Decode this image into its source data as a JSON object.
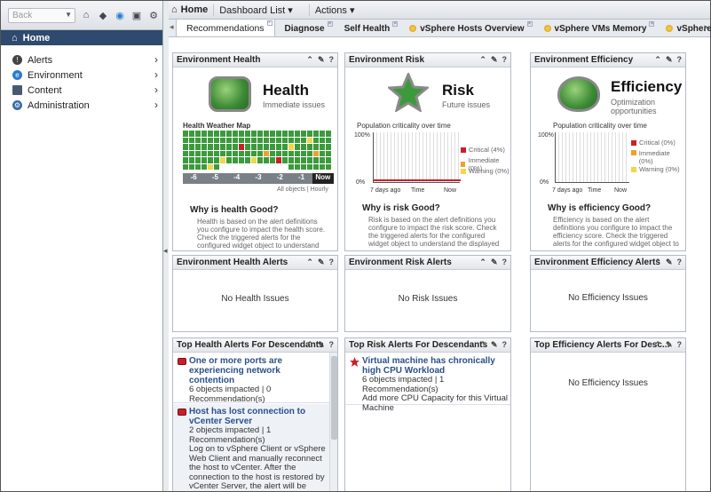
{
  "left": {
    "back_label": "Back",
    "home_label": "Home",
    "nav": [
      {
        "label": "Alerts"
      },
      {
        "label": "Environment"
      },
      {
        "label": "Content"
      },
      {
        "label": "Administration"
      }
    ]
  },
  "toolbar": {
    "home": "Home",
    "dashboard_list": "Dashboard List",
    "actions": "Actions"
  },
  "tabs": [
    "Recommendations",
    "Diagnose",
    "Self Health",
    "vSphere Hosts Overview",
    "vSphere VMs Memory",
    "vSphere V"
  ],
  "health": {
    "header": "Environment Health",
    "title": "Health",
    "subtitle": "Immediate issues",
    "map_title": "Health Weather Map",
    "times": [
      "-6",
      "-5",
      "-4",
      "-3",
      "-2",
      "-1",
      "Now"
    ],
    "footer": "All objects | Hourly",
    "why": "Why is health Good?",
    "desc": "Health is based on the alert definitions you configure to impact the health score. Check the triggered alerts for the configured widget object to understand the displayed state, including"
  },
  "risk": {
    "header": "Environment Risk",
    "title": "Risk",
    "subtitle": "Future issues",
    "plot_title": "Population criticality over time",
    "y_top": "100%",
    "y_bottom": "0%",
    "x_labels": [
      "7 days ago",
      "Time",
      "Now"
    ],
    "legend": [
      "Critical (4%)",
      "Immediate (0%)",
      "Warning (0%)"
    ],
    "why": "Why is risk Good?",
    "desc": "Risk is based on the alert definitions you configure to impact the risk score. Check the triggered alerts for the configured widget object to understand the displayed state, including child objects."
  },
  "eff": {
    "header": "Environment Efficiency",
    "title": "Efficiency",
    "subtitle": "Optimization opportunities",
    "plot_title": "Population criticality over time",
    "y_top": "100%",
    "y_bottom": "0%",
    "x_labels": [
      "7 days ago",
      "Time",
      "Now"
    ],
    "legend": [
      "Critical (0%)",
      "Immediate (0%)",
      "Warning (0%)"
    ],
    "why": "Why is efficiency Good?",
    "desc": "Efficiency is based on the alert definitions you configure to impact the efficiency score. Check the triggered alerts for the configured widget object to understand the"
  },
  "alerts": {
    "health_header": "Environment Health Alerts",
    "health_empty": "No Health Issues",
    "risk_header": "Environment Risk Alerts",
    "risk_empty": "No Risk Issues",
    "eff_header": "Environment Efficiency Alerts",
    "eff_empty": "No Efficiency Issues"
  },
  "top": {
    "health_header": "Top Health Alerts For Descendants",
    "health_items": [
      {
        "title": "One or more ports are experiencing network contention",
        "text": "6 objects impacted | 0 Recommendation(s)\nNo Recommendation Available"
      },
      {
        "title": "Host has lost connection to vCenter Server",
        "text": "2 objects impacted | 1 Recommendation(s)\nLog on to vSphere Client or vSphere Web Client and manually reconnect the host to vCenter. After the connection to the host is restored by vCenter Server, the alert will be canceled"
      }
    ],
    "risk_header": "Top Risk Alerts For Descendants",
    "risk_items": [
      {
        "title": "Virtual machine has chronically high CPU Workload",
        "text": "6 objects impacted | 1 Recommendation(s)\nAdd more CPU Capacity for this Virtual Machine"
      }
    ],
    "eff_header": "Top Efficiency Alerts For Desc...",
    "eff_empty": "No Efficiency Issues"
  },
  "colors": {
    "green": "#3c9a3c",
    "yellow": "#f0d64a",
    "orange": "#f0a030",
    "red": "#c8202a",
    "nav_dark": "#2e4a6e",
    "link": "#2a4f8a"
  }
}
